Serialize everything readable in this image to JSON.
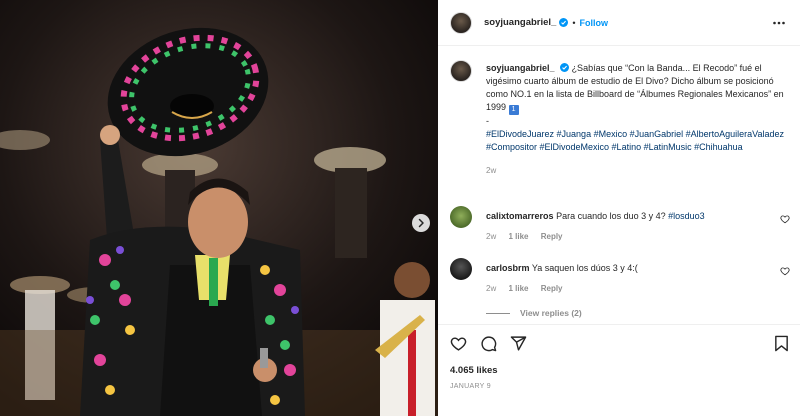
{
  "header": {
    "username": "soyjuangabriel_",
    "separator": "•",
    "follow_label": "Follow"
  },
  "caption": {
    "username": "soyjuangabriel_",
    "text": "¿Sabías que “Con la Banda... El Recodo” fué el vigésimo cuarto álbum de estudio de El Divo? Dicho álbum se posicionó como NO.1 en la lista de Billboard de “Álbumes Regionales Mexicanos” en 1999",
    "emoji": "1",
    "dash": "-",
    "hashtags": "#ElDivodeJuarez #Juanga #Mexico #JuanGabriel #AlbertoAguileraValadez #Compositor #ElDivodeMexico #Latino #LatinMusic #Chihuahua",
    "age": "2w"
  },
  "comments": [
    {
      "username": "calixtomarreros",
      "text": "Para cuando los duo 3 y 4?",
      "hashtag": "#losduo3",
      "age": "2w",
      "likes": "1 like",
      "reply_label": "Reply"
    },
    {
      "username": "carlosbrm",
      "text": "Ya saquen los dúos 3 y 4:(",
      "hashtag": "",
      "age": "2w",
      "likes": "1 like",
      "reply_label": "Reply"
    }
  ],
  "view_replies_label": "View replies (2)",
  "post": {
    "likes": "4.065 likes",
    "date": "JANUARY 9"
  },
  "icons": {
    "more": "more-options-icon",
    "verified": "verified-badge-icon",
    "like": "heart-icon",
    "comment": "comment-icon",
    "share": "share-icon",
    "save": "bookmark-icon",
    "next": "chevron-right-icon"
  },
  "colors": {
    "link_blue": "#0095f6",
    "hashtag": "#00376b",
    "muted": "#8e8e8e",
    "verified": "#0095f6"
  }
}
